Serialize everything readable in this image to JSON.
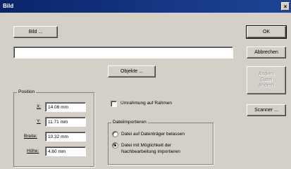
{
  "window": {
    "title": "Bild",
    "close_glyph": "×"
  },
  "file_button": "Bild ...",
  "path_field": {
    "value": ""
  },
  "objects_button": "Objekte ...",
  "position": {
    "legend": "Position",
    "x_label": "X:",
    "x_value": "14.08 mm",
    "y_label": "Y:",
    "y_value": "11.71 mm",
    "width_label": "Breite:",
    "width_value": "10.32 mm",
    "height_label": "Höhe:",
    "height_value": "4.60 mm"
  },
  "frame_check": {
    "label": "Umrahmung auf Rahmen",
    "checked": false
  },
  "import": {
    "legend": "Dateiimportieren",
    "option1": "Datei auf Datenträger belassen",
    "option2_line1": "Datei mit Möglichkeit der",
    "option2_line2": "Nachbearbeitung importieren",
    "selected": 2
  },
  "buttons": {
    "ok": "OK",
    "cancel": "Abbrechen",
    "disabled_line1": "Ändern",
    "disabled_line2": "Datei",
    "disabled_line3": "ändern",
    "scanner": "Scanner ..."
  }
}
